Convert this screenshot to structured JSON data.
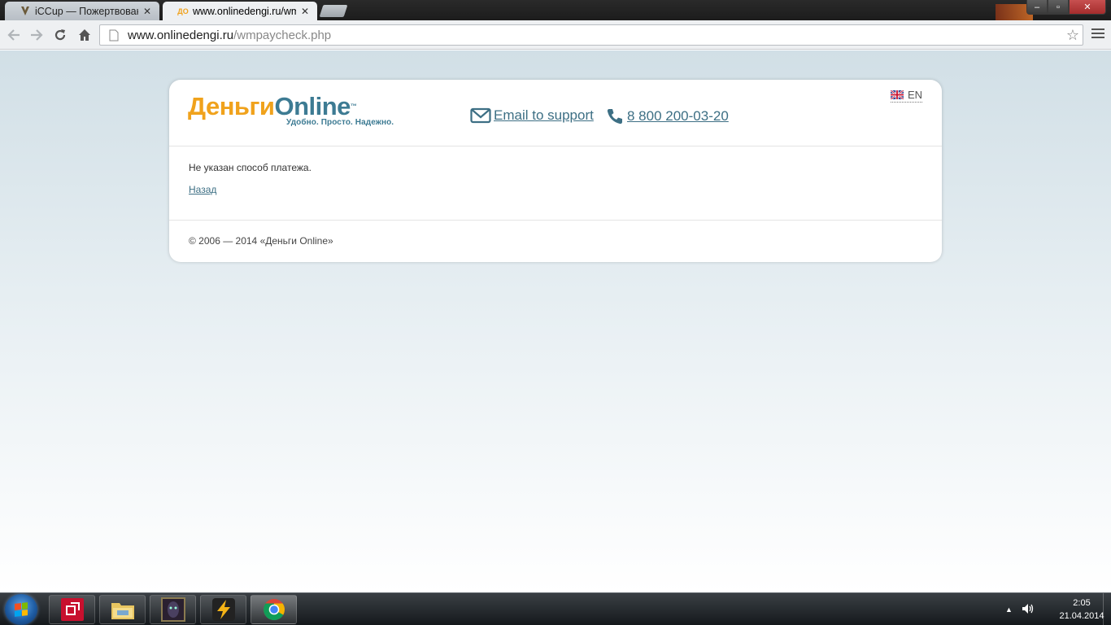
{
  "browser": {
    "tabs": [
      {
        "title": "iCCup — Пожертвования",
        "favicon": "iccup-favicon"
      },
      {
        "title": "www.onlinedengi.ru/wmp",
        "favicon": "dengi-online-favicon",
        "favicon_text": "ДО"
      }
    ],
    "url_host": "www.onlinedengi.ru",
    "url_path": "/wmpaycheck.php",
    "window_controls": {
      "minimize": "‒",
      "maximize": "▫",
      "close": "✕"
    }
  },
  "site": {
    "logo_ru": "Деньги",
    "logo_en": "Online",
    "logo_tm": "™",
    "tagline": "Удобно. Просто. Надежно.",
    "email_label": "Email to support",
    "phone_label": "8 800 200-03-20",
    "lang_label": "EN"
  },
  "content": {
    "message": "Не указан способ платежа.",
    "back_link": "Назад"
  },
  "footer": {
    "copyright": "© 2006 — 2014 «Деньги Online»"
  },
  "taskbar": {
    "items": [
      "app-red-icon",
      "file-explorer-icon",
      "game-icon",
      "winamp-icon",
      "chrome-icon"
    ],
    "time": "2:05",
    "date": "21.04.2014"
  },
  "colors": {
    "logo_orange": "#f0a21c",
    "logo_teal": "#3d7b93",
    "link": "#3d6f84",
    "page_bg_top": "#d1dfe6"
  }
}
